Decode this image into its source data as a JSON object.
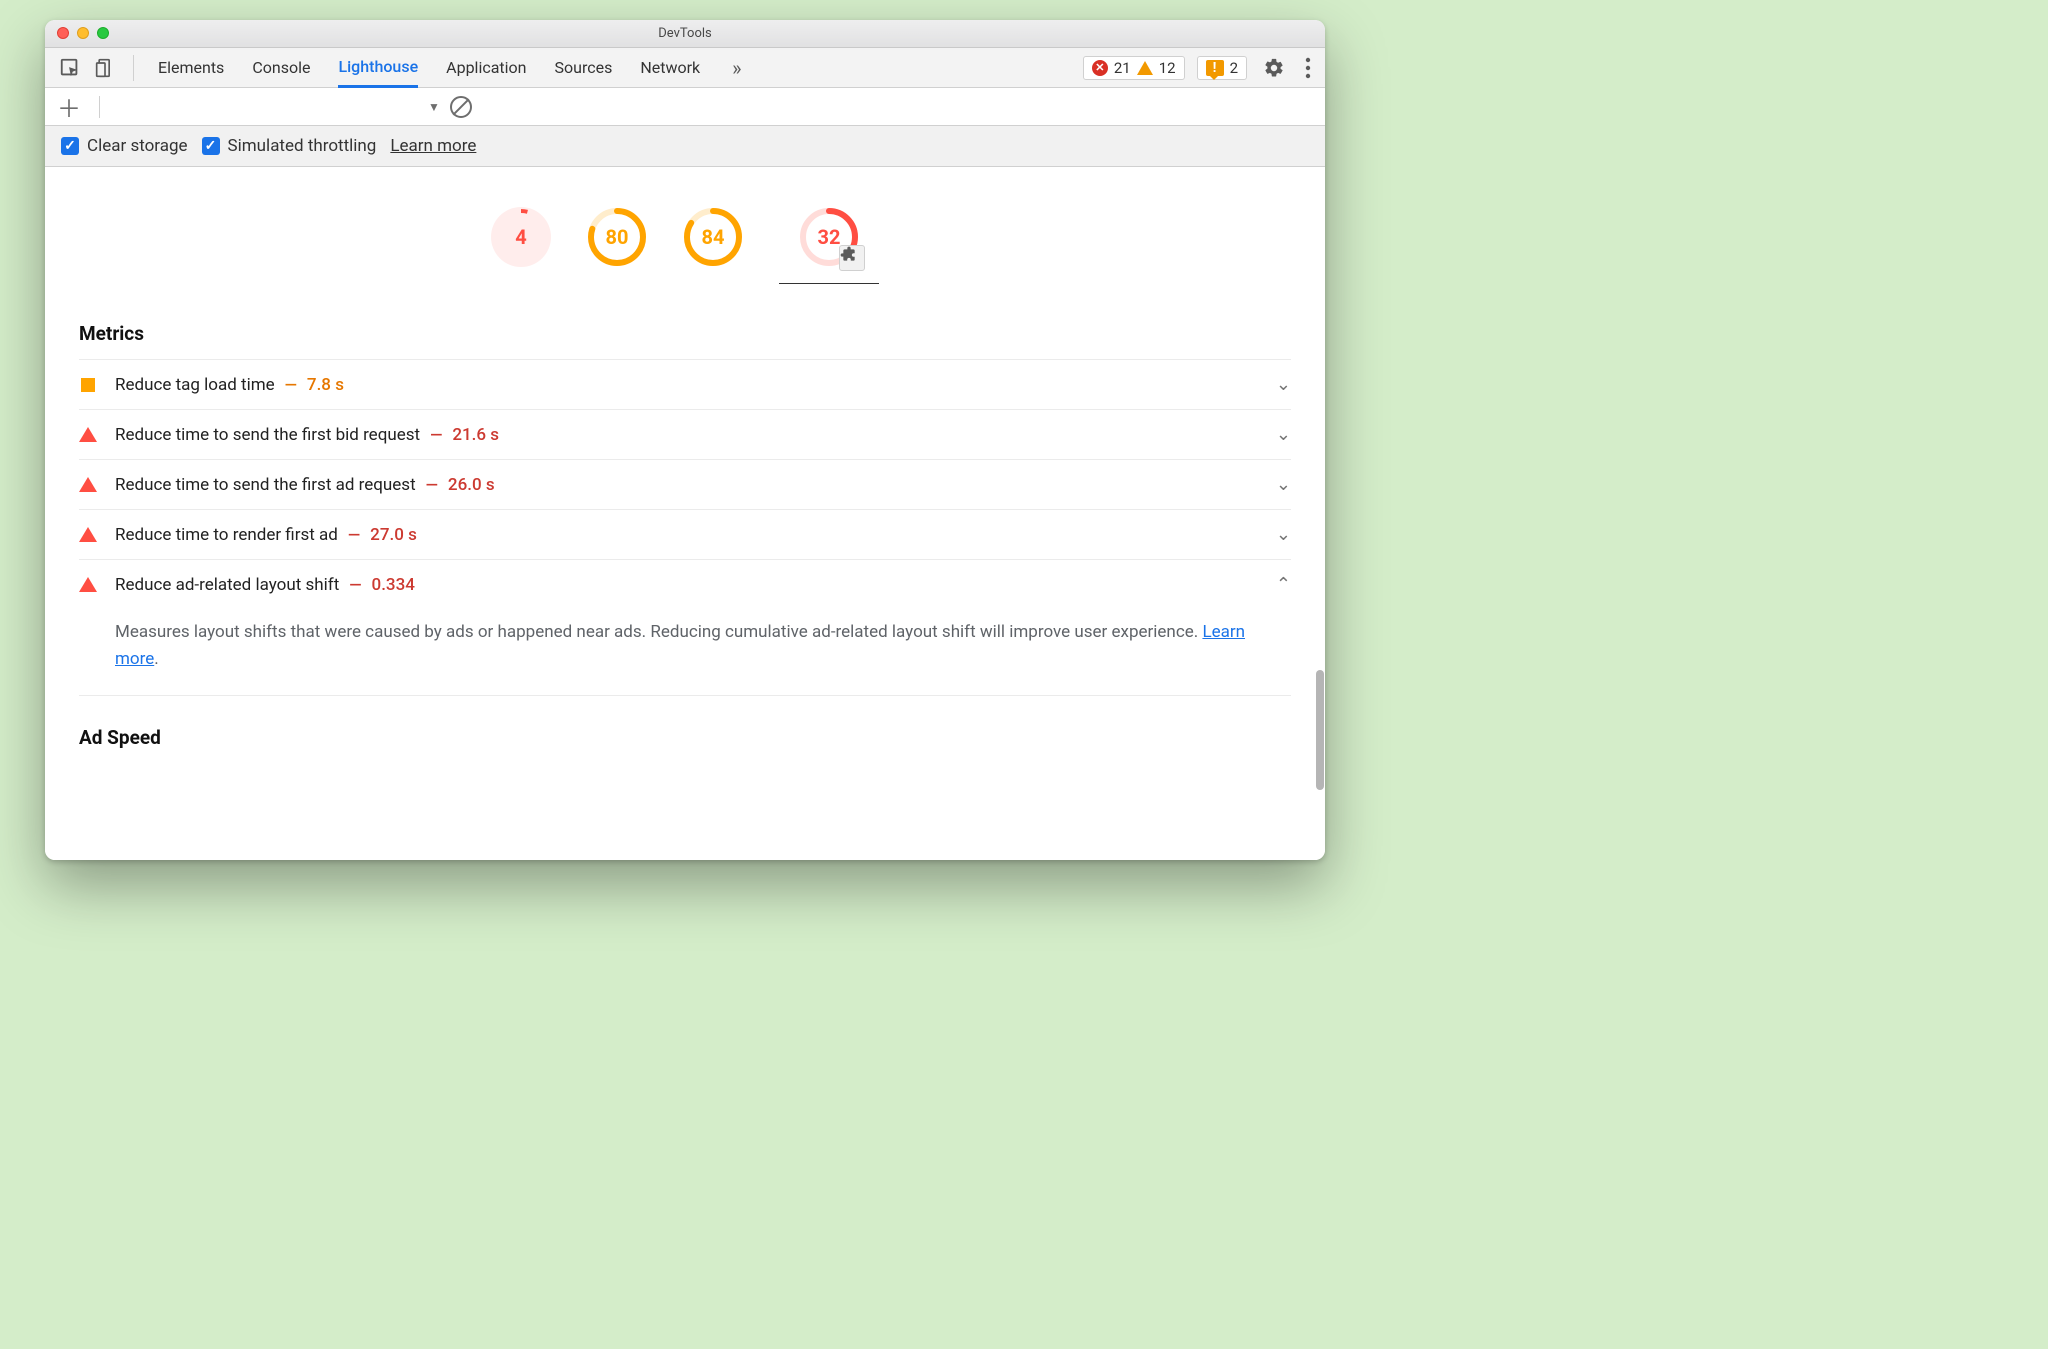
{
  "window": {
    "title": "DevTools"
  },
  "tabs": {
    "items": [
      "Elements",
      "Console",
      "Lighthouse",
      "Application",
      "Sources",
      "Network"
    ],
    "active_index": 2
  },
  "badges": {
    "errors": "21",
    "warnings": "12",
    "issues": "2"
  },
  "options": {
    "clear_storage": "Clear storage",
    "simulated_throttling": "Simulated throttling",
    "learn_more": "Learn more"
  },
  "gauges": [
    {
      "score": "4",
      "pct": 4,
      "color": "#ff4e42",
      "fill": true
    },
    {
      "score": "80",
      "pct": 80,
      "color": "#ffa400",
      "fill": false
    },
    {
      "score": "84",
      "pct": 84,
      "color": "#ffa400",
      "fill": false
    },
    {
      "score": "32",
      "pct": 32,
      "color": "#ff4e42",
      "fill": false,
      "plugin": true,
      "underline": true
    }
  ],
  "section_metrics_title": "Metrics",
  "metrics": [
    {
      "status": "avg",
      "name": "Reduce tag load time",
      "value": "7.8 s",
      "expanded": false
    },
    {
      "status": "fail",
      "name": "Reduce time to send the first bid request",
      "value": "21.6 s",
      "expanded": false
    },
    {
      "status": "fail",
      "name": "Reduce time to send the first ad request",
      "value": "26.0 s",
      "expanded": false
    },
    {
      "status": "fail",
      "name": "Reduce time to render first ad",
      "value": "27.0 s",
      "expanded": false
    },
    {
      "status": "fail",
      "name": "Reduce ad-related layout shift",
      "value": "0.334",
      "expanded": true,
      "desc_pre": "Measures layout shifts that were caused by ads or happened near ads. Reducing cumulative ad-related layout shift will improve user experience. ",
      "desc_link": "Learn more",
      "desc_post": "."
    }
  ],
  "section_adspeed_title": "Ad Speed"
}
